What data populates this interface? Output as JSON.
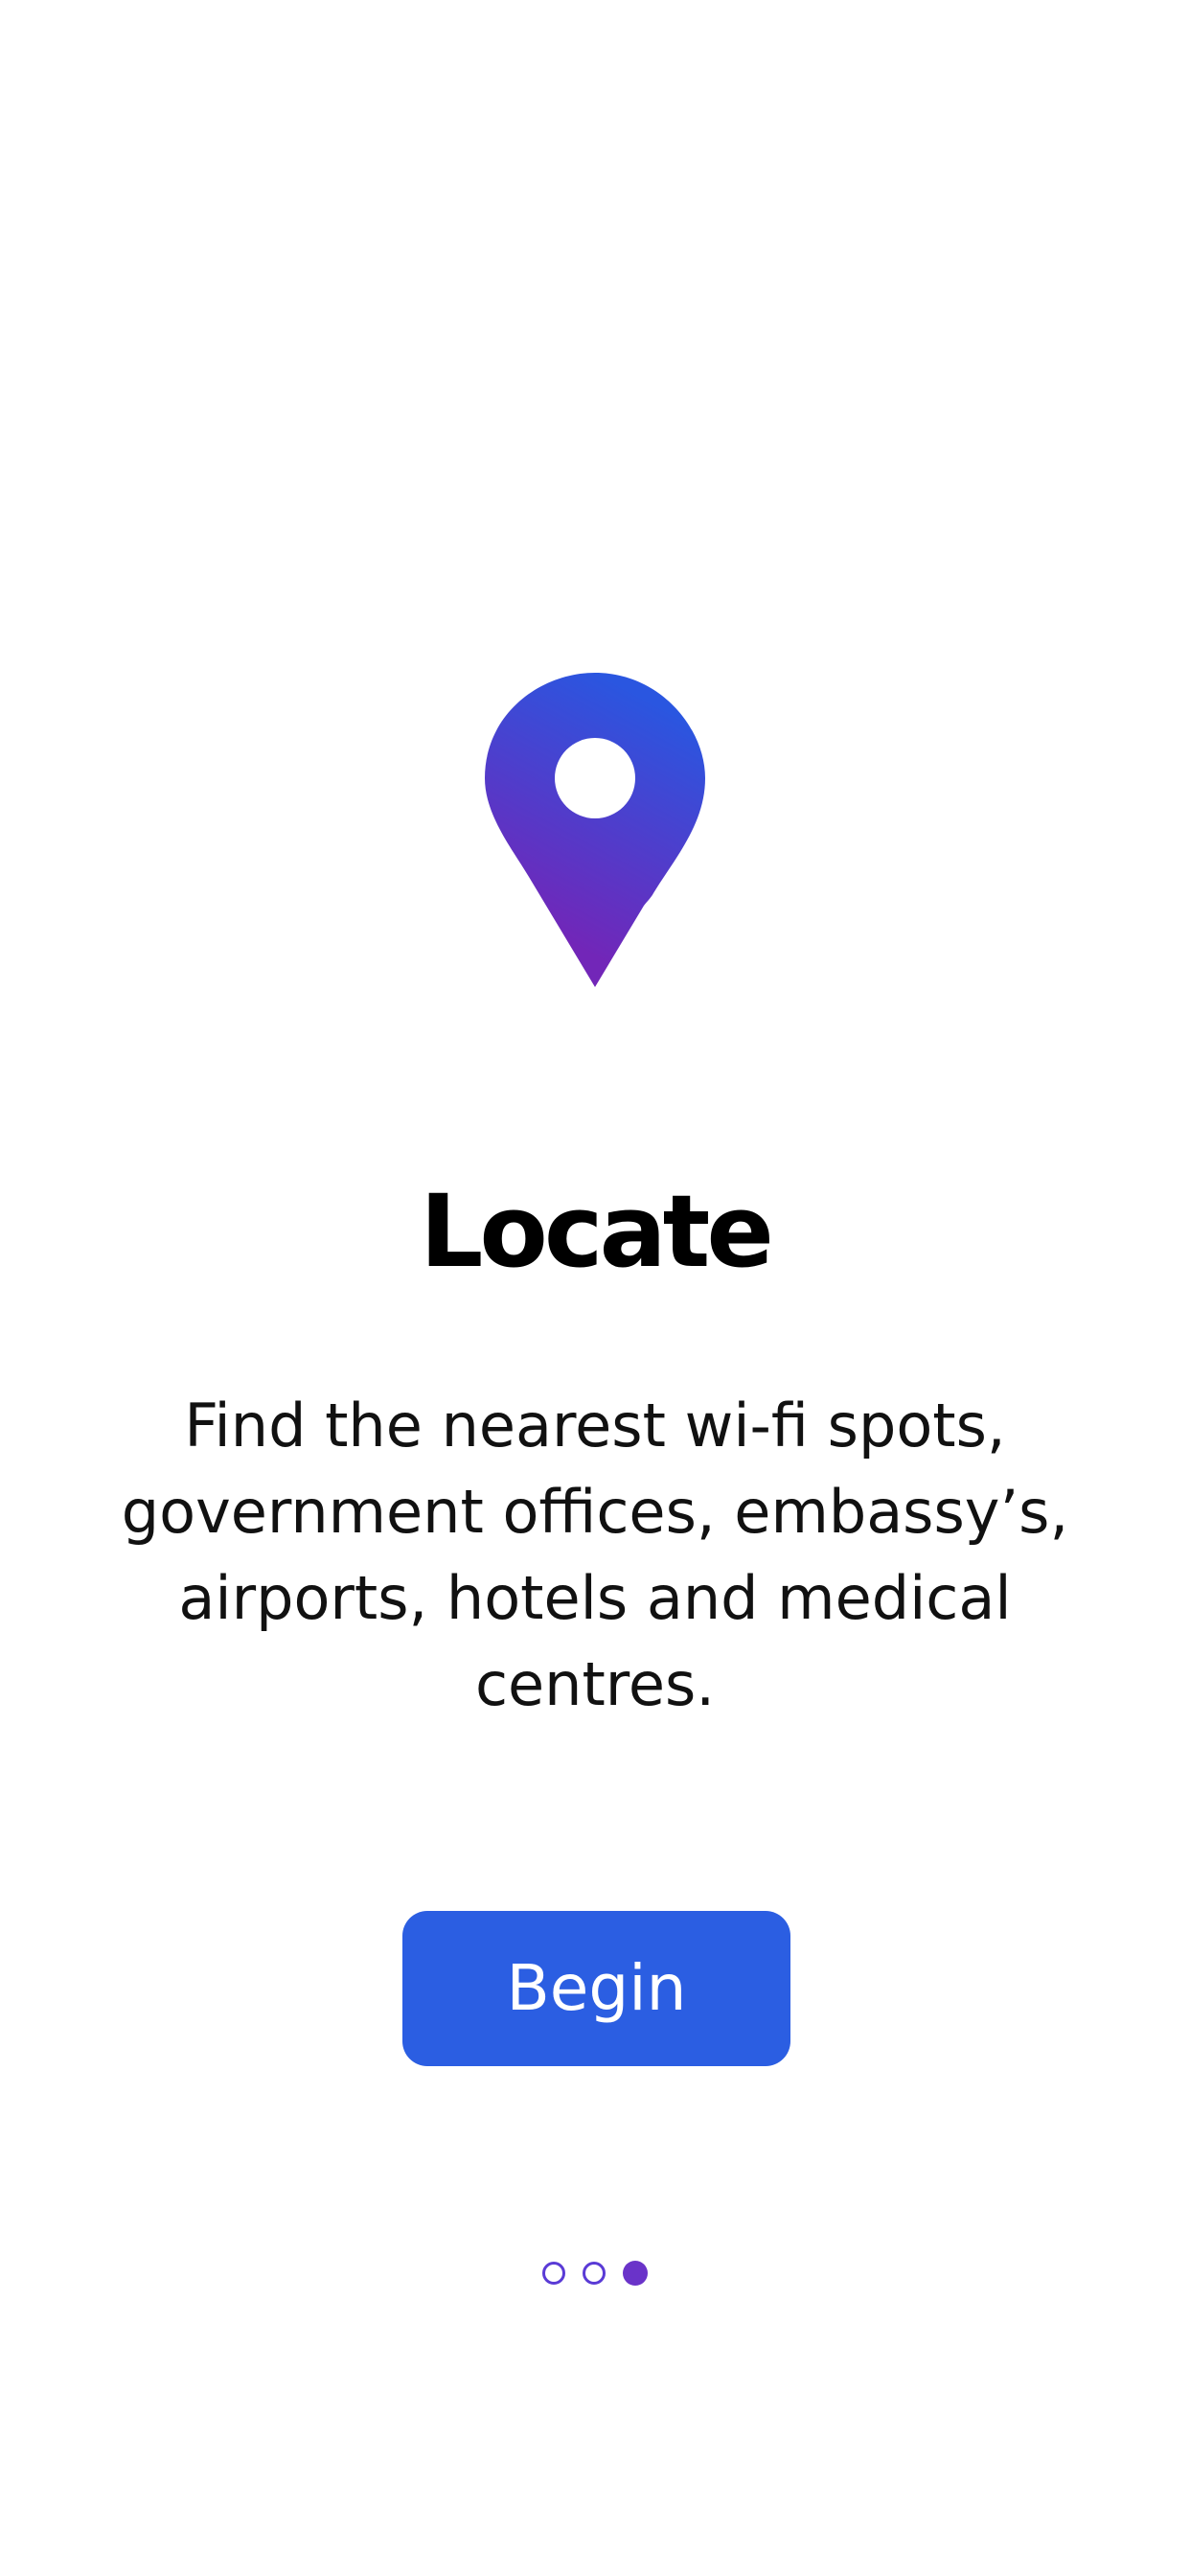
{
  "onboarding": {
    "icon": "map-pin-icon",
    "title": "Locate",
    "description": "Find the nearest wi-fi spots, government offices, embassy’s, airports, hotels and medical centres.",
    "begin_label": "Begin",
    "page_indicator": {
      "total": 3,
      "current": 3
    }
  },
  "colors": {
    "accent": "#2b5ee2",
    "pin_gradient_top": "#2a56e0",
    "pin_gradient_bottom": "#7226b8",
    "indicator": "#6a33c9"
  }
}
